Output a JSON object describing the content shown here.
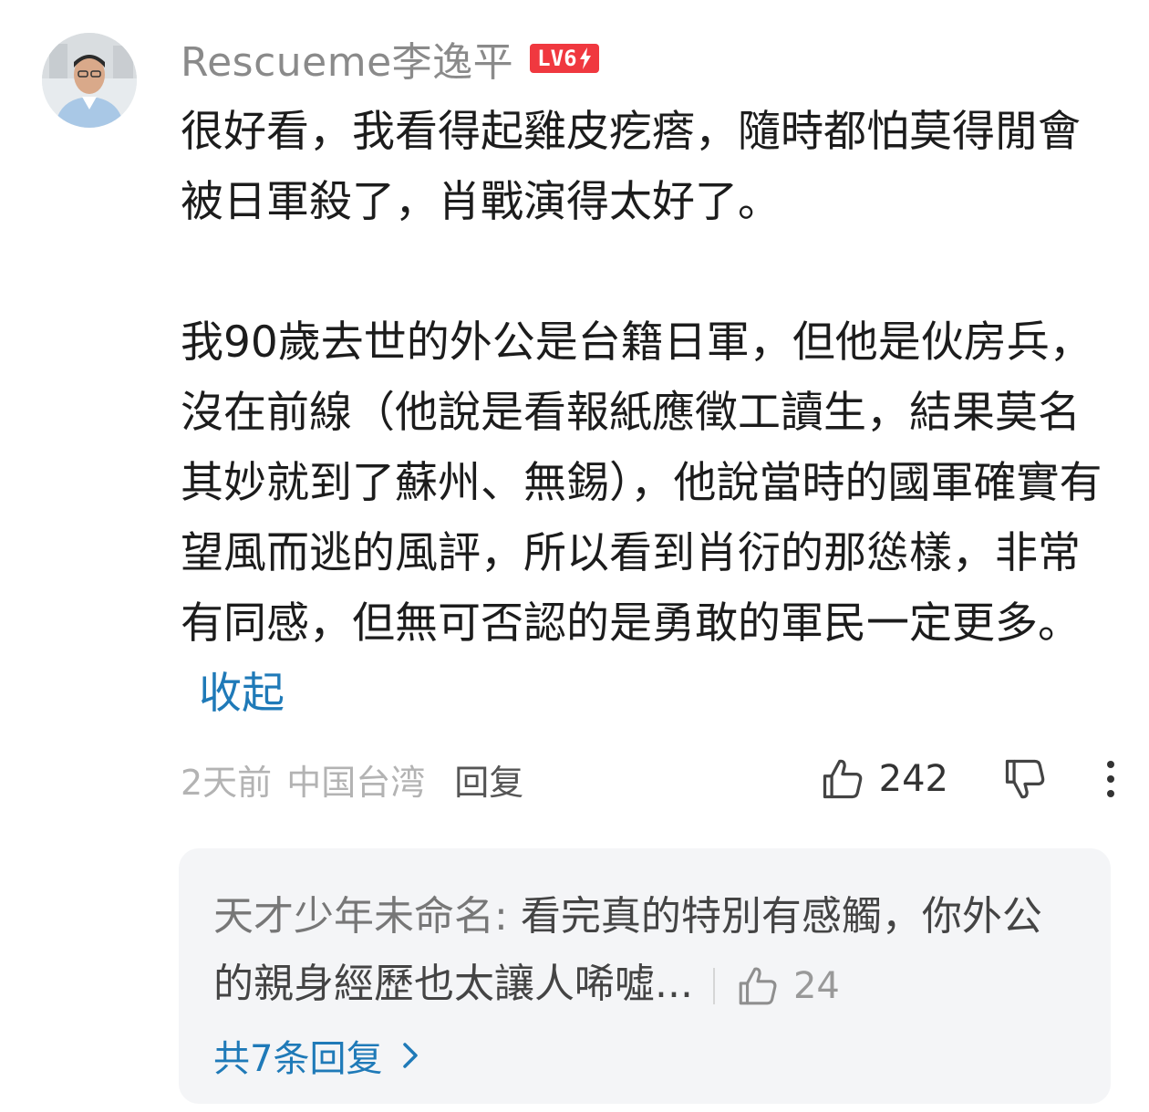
{
  "comment": {
    "username": "Rescueme李逸平",
    "level_badge": "LV6",
    "paragraph1": "很好看，我看得起雞皮疙瘩，隨時都怕莫得閒會被日軍殺了，肖戰演得太好了。",
    "paragraph2": "我90歲去世的外公是台籍日軍，但他是伙房兵，沒在前線（他說是看報紙應徵工讀生，結果莫名其妙就到了蘇州、無錫），他說當時的國軍確實有望風而逃的風評，所以看到肖衍的那慫樣，非常有同感，但無可否認的是勇敢的軍民一定更多。",
    "collapse_label": "收起",
    "time": "2天前",
    "location": "中国台湾",
    "reply_label": "回复",
    "like_count": "242",
    "like_icon": "thumbs-up-icon",
    "dislike_icon": "thumbs-down-icon",
    "more_icon": "more-vertical-icon"
  },
  "reply_preview": {
    "author": "天才少年未命名:",
    "text": "看完真的特別有感觸，你外公的親身經歷也太讓人唏噓...",
    "like_count": "24",
    "total_label": "共7条回复",
    "chevron_icon": "chevron-right-icon"
  },
  "colors": {
    "link_blue": "#1f7ab8",
    "badge_red": "#f0383f",
    "reply_bg": "#f4f5f7"
  }
}
